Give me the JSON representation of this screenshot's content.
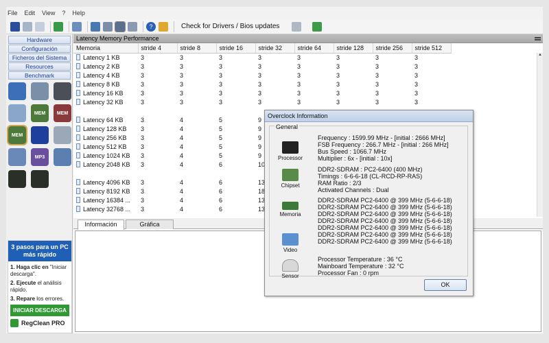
{
  "menu": [
    "File",
    "Edit",
    "View",
    "?",
    "Help"
  ],
  "toolbar": {
    "check_label": "Check for Drivers / Bios updates"
  },
  "sidebar": {
    "nav": [
      "Hardware",
      "Configuración",
      "Ficheros del Sistema",
      "Resources",
      "Benchmark"
    ],
    "icons": [
      [
        "cpu-benchmark-icon",
        "cpu-disk-icon",
        "disk-benchmark-icon"
      ],
      [
        "network-icon",
        "memory-icon",
        "memory-test-icon"
      ],
      [
        "memory-latency-icon",
        "zip-icon",
        "dvd-icon"
      ],
      [
        "cd-benchmark-icon",
        "mp3-icon",
        "tools-icon"
      ],
      [
        "nvidia-icon",
        "nvidia-2-icon",
        ""
      ]
    ],
    "icon_labels": {
      "memory-icon": "MEM",
      "memory-test-icon": "MEM",
      "memory-latency-icon": "MEM",
      "mp3-icon": "MP3"
    }
  },
  "ad": {
    "title": "3 pasos para un PC más rápido",
    "step1_bold": "1. Haga clic en",
    "step1_rest": " \"Iniciar descarga\".",
    "step2_bold": "2. Ejecute",
    "step2_rest": " el análisis rápido.",
    "step3_bold": "3. Repare",
    "step3_rest": " los errores.",
    "cta": "INICIAR DESCARGA",
    "brand": "RegClean PRO"
  },
  "panel": {
    "title": "Latency Memory Performance",
    "columns": [
      "Memoria",
      "stride 4",
      "stride 8",
      "stride 16",
      "stride 32",
      "stride 64",
      "stride 128",
      "stride 256",
      "stride 512"
    ],
    "rows": [
      [
        "Latency 1   KB",
        "3",
        "3",
        "3",
        "3",
        "3",
        "3",
        "3",
        "3"
      ],
      [
        "Latency 2   KB",
        "3",
        "3",
        "3",
        "3",
        "3",
        "3",
        "3",
        "3"
      ],
      [
        "Latency 4   KB",
        "3",
        "3",
        "3",
        "3",
        "3",
        "3",
        "3",
        "3"
      ],
      [
        "Latency 8   KB",
        "3",
        "3",
        "3",
        "3",
        "3",
        "3",
        "3",
        "3"
      ],
      [
        "Latency 16   KB",
        "3",
        "3",
        "3",
        "3",
        "3",
        "3",
        "3",
        "3"
      ],
      [
        "Latency 32   KB",
        "3",
        "3",
        "3",
        "3",
        "3",
        "3",
        "3",
        "3"
      ],
      [
        "",
        "",
        "",
        "",
        "",
        "",
        "",
        "",
        ""
      ],
      [
        "Latency 64   KB",
        "3",
        "4",
        "5",
        "9",
        "",
        "",
        "",
        ""
      ],
      [
        "Latency 128   KB",
        "3",
        "4",
        "5",
        "9",
        "",
        "",
        "",
        ""
      ],
      [
        "Latency 256   KB",
        "3",
        "4",
        "5",
        "9",
        "",
        "",
        "",
        ""
      ],
      [
        "Latency 512   KB",
        "3",
        "4",
        "5",
        "9",
        "",
        "",
        "",
        ""
      ],
      [
        "Latency 1024   KB",
        "3",
        "4",
        "5",
        "9",
        "",
        "",
        "",
        ""
      ],
      [
        "Latency 2048   KB",
        "3",
        "4",
        "6",
        "10",
        "",
        "",
        "",
        ""
      ],
      [
        "",
        "",
        "",
        "",
        "",
        "",
        "",
        "",
        ""
      ],
      [
        "Latency 4096   KB",
        "3",
        "4",
        "6",
        "13",
        "",
        "",
        "",
        ""
      ],
      [
        "Latency 8192   KB",
        "3",
        "4",
        "6",
        "18",
        "",
        "",
        "",
        ""
      ],
      [
        "Latency 16384   ...",
        "3",
        "4",
        "6",
        "13",
        "",
        "",
        "",
        ""
      ],
      [
        "Latency 32768   ...",
        "3",
        "4",
        "6",
        "13",
        "",
        "",
        "",
        ""
      ]
    ]
  },
  "tabs": [
    "Información",
    "Gráfica"
  ],
  "dialog": {
    "title": "Overclock Information",
    "group": "General",
    "processor": {
      "label": "Processor",
      "lines": [
        "Frequency : 1599.99 MHz  -  [initial : 2666 MHz]",
        "FSB Frequency : 266.7 MHz  -  [initial : 266 MHz]",
        "Bus Speed : 1066.7 MHz",
        "Multiplier : 6x  -  [initial : 10x]"
      ]
    },
    "chipset": {
      "label": "Chipset",
      "lines": [
        "DDR2-SDRAM : PC2-6400 (400 MHz)",
        "Timings : 6-6-6-18 (CL-RCD-RP-RAS)",
        "RAM Ratio : 2/3",
        "Activated Channels : Dual"
      ]
    },
    "memoria": {
      "label": "Memoria",
      "lines": [
        "DDR2-SDRAM PC2-6400 @ 399 MHz (5-6-6-18)",
        "DDR2-SDRAM PC2-6400 @ 399 MHz (5-6-6-18)",
        "DDR2-SDRAM PC2-6400 @ 399 MHz (5-6-6-18)",
        "DDR2-SDRAM PC2-6400 @ 399 MHz (5-6-6-18)",
        "DDR2-SDRAM PC2-6400 @ 399 MHz (5-6-6-18)",
        "DDR2-SDRAM PC2-6400 @ 399 MHz (5-6-6-18)",
        "DDR2-SDRAM PC2-6400 @ 399 MHz (5-6-6-18)"
      ]
    },
    "video": {
      "label": "Video"
    },
    "sensor": {
      "label": "Sensor",
      "lines": [
        "Processor Temperature : 36 °C",
        "Mainboard Temperature : 32 °C",
        "Processor Fan : 0 rpm"
      ]
    },
    "ok": "OK"
  }
}
